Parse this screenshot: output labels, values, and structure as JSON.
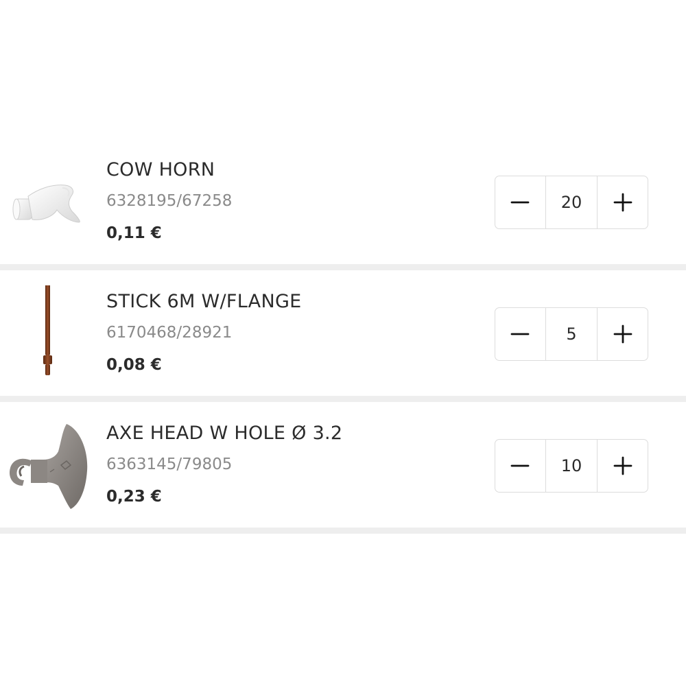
{
  "items": [
    {
      "name": "COW HORN",
      "sku": "6328195/67258",
      "price": "0,11 €",
      "quantity": "20",
      "image_icon": "cow-horn-image",
      "color": "#f2f2f2"
    },
    {
      "name": "STICK 6M W/FLANGE",
      "sku": "6170468/28921",
      "price": "0,08 €",
      "quantity": "5",
      "image_icon": "stick-image",
      "color": "#7a3b1c"
    },
    {
      "name": "AXE HEAD W HOLE Ø 3.2",
      "sku": "6363145/79805",
      "price": "0,23 €",
      "quantity": "10",
      "image_icon": "axe-head-image",
      "color": "#8e8985"
    }
  ],
  "stepper": {
    "decrement_icon": "minus-icon",
    "increment_icon": "plus-icon"
  }
}
